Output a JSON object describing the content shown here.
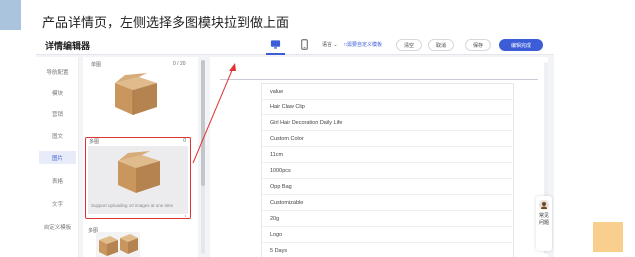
{
  "caption": "产品详情页，左侧选择多图模块拉到做上面",
  "editor": {
    "title": "详情编辑器",
    "language": "语言",
    "custom_template_link": "□需要自定义模板",
    "buttons": {
      "clear": "清空",
      "cancel": "取消",
      "save": "保存",
      "finish": "编辑完成"
    }
  },
  "sidebar": {
    "items": [
      {
        "label": "导航配置",
        "active": false
      },
      {
        "label": "模块",
        "active": false
      },
      {
        "label": "营销",
        "active": false
      },
      {
        "label": "图文",
        "active": false
      },
      {
        "label": "图片",
        "active": true
      },
      {
        "label": "表格",
        "active": false
      },
      {
        "label": "文字",
        "active": false
      },
      {
        "label": "自定义模板",
        "active": false
      }
    ]
  },
  "module_panel": {
    "tiles": [
      {
        "label": "单图",
        "count": "0 / 20"
      },
      {
        "label": "多图",
        "count": "0",
        "hint": "Support uploading 10 images at one time"
      },
      {
        "label": "多图"
      }
    ]
  },
  "spec_table": {
    "rows": [
      "value",
      "Hair Claw Clip",
      "Girl Hair Decoration Daily Life",
      "Custom Color",
      "11cm",
      "1000pcs",
      "Opp Bag",
      "Customizable",
      "20g",
      "Logo",
      "5 Days"
    ]
  },
  "help_widget": {
    "label": "常见问题"
  },
  "colors": {
    "accent": "#3c5cd8",
    "highlight": "#e03434",
    "note": "#f8cf8c"
  }
}
